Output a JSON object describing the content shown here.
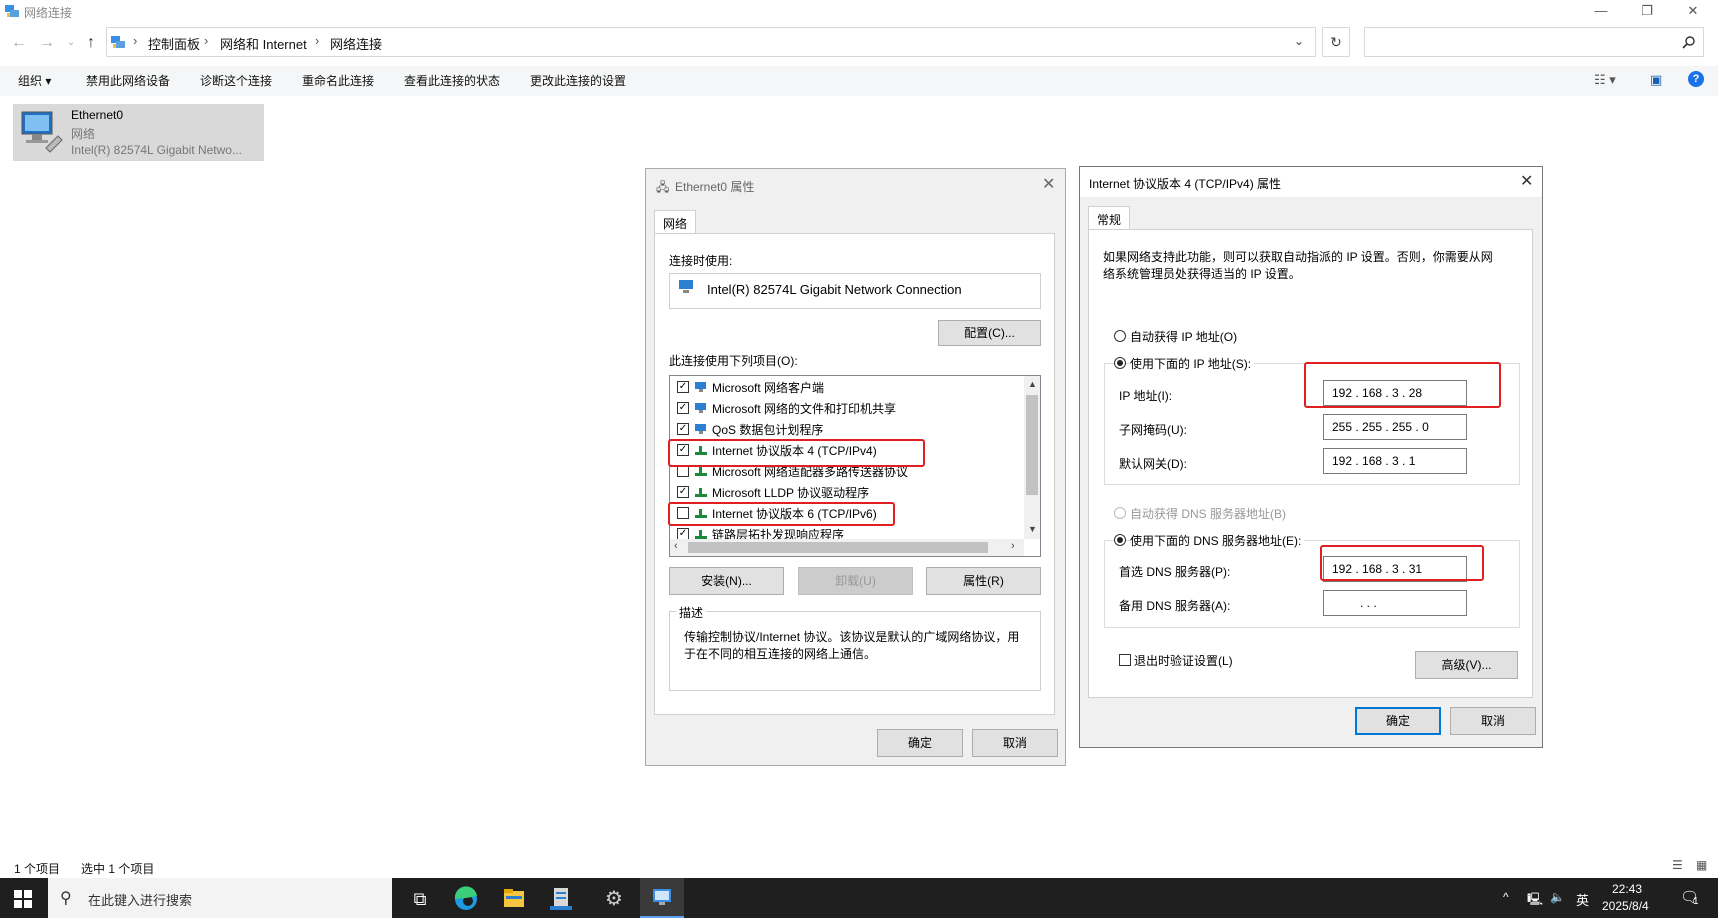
{
  "window": {
    "title": "网络连接",
    "controls": {
      "minimize": "—",
      "restore": "❐",
      "close": "✕"
    }
  },
  "address": {
    "crumbs": [
      "控制面板",
      "网络和 Internet",
      "网络连接"
    ],
    "search_placeholder": ""
  },
  "commands": [
    "组织 ▾",
    "禁用此网络设备",
    "诊断这个连接",
    "重命名此连接",
    "查看此连接的状态",
    "更改此连接的设置"
  ],
  "item": {
    "name": "Ethernet0",
    "type": "网络",
    "adapter": "Intel(R) 82574L Gigabit Netwo..."
  },
  "statusbar": {
    "count": "1 个项目",
    "selected": "选中 1 个项目"
  },
  "taskbar": {
    "search_text": "在此键入进行搜索",
    "lang": "英",
    "time": "22:43",
    "date": "2025/8/4",
    "notif": "1"
  },
  "eth_dialog": {
    "title": "Ethernet0 属性",
    "tab": "网络",
    "connect_using_label": "连接时使用:",
    "adapter_name": "Intel(R) 82574L Gigabit Network Connection",
    "configure_btn": "配置(C)...",
    "items_label": "此连接使用下列项目(O):",
    "items": [
      {
        "label": "Microsoft 网络客户端",
        "checked": true
      },
      {
        "label": "Microsoft 网络的文件和打印机共享",
        "checked": true
      },
      {
        "label": "QoS 数据包计划程序",
        "checked": true
      },
      {
        "label": "Internet 协议版本 4 (TCP/IPv4)",
        "checked": true
      },
      {
        "label": "Microsoft 网络适配器多路传送器协议",
        "checked": false
      },
      {
        "label": "Microsoft LLDP 协议驱动程序",
        "checked": true
      },
      {
        "label": "Internet 协议版本 6 (TCP/IPv6)",
        "checked": false
      },
      {
        "label": "链路层拓扑发现响应程序",
        "checked": true
      }
    ],
    "install_btn": "安装(N)...",
    "uninstall_btn": "卸载(U)",
    "properties_btn": "属性(R)",
    "desc_label": "描述",
    "desc_text_1": "传输控制协议/Internet 协议。该协议是默认的广域网络协议，用",
    "desc_text_2": "于在不同的相互连接的网络上通信。",
    "ok_btn": "确定",
    "cancel_btn": "取消"
  },
  "ipv4_dialog": {
    "title": "Internet 协议版本 4 (TCP/IPv4) 属性",
    "tab": "常规",
    "intro_1": "如果网络支持此功能，则可以获取自动指派的 IP 设置。否则，你需要从网",
    "intro_2": "络系统管理员处获得适当的 IP 设置。",
    "auto_ip": "自动获得 IP 地址(O)",
    "manual_ip": "使用下面的 IP 地址(S):",
    "ip_label": "IP 地址(I):",
    "ip_value": "192 . 168 .  3  .  28",
    "mask_label": "子网掩码(U):",
    "mask_value": "255 . 255 . 255 .  0",
    "gw_label": "默认网关(D):",
    "gw_value": "192 . 168 .  3  .  1",
    "auto_dns": "自动获得 DNS 服务器地址(B)",
    "manual_dns": "使用下面的 DNS 服务器地址(E):",
    "pref_dns_label": "首选 DNS 服务器(P):",
    "pref_dns_value": "192 . 168 .  3  .  31",
    "alt_dns_label": "备用 DNS 服务器(A):",
    "alt_dns_value": ".        .        .",
    "validate_label": "退出时验证设置(L)",
    "advanced_btn": "高级(V)...",
    "ok_btn": "确定",
    "cancel_btn": "取消"
  }
}
